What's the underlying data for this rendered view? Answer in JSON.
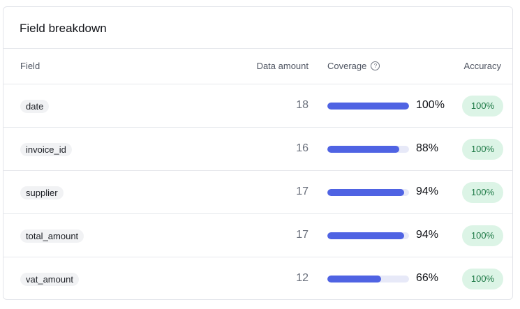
{
  "card": {
    "title": "Field breakdown"
  },
  "columns": {
    "field": "Field",
    "data_amount": "Data amount",
    "coverage": "Coverage",
    "accuracy": "Accuracy",
    "coverage_help_icon": "question-circle-icon"
  },
  "rows": [
    {
      "field": "date",
      "data_amount": "18",
      "coverage": "100%",
      "coverage_fraction": 1.0,
      "accuracy": "100%"
    },
    {
      "field": "invoice_id",
      "data_amount": "16",
      "coverage": "88%",
      "coverage_fraction": 0.88,
      "accuracy": "100%"
    },
    {
      "field": "supplier",
      "data_amount": "17",
      "coverage": "94%",
      "coverage_fraction": 0.94,
      "accuracy": "100%"
    },
    {
      "field": "total_amount",
      "data_amount": "17",
      "coverage": "94%",
      "coverage_fraction": 0.94,
      "accuracy": "100%"
    },
    {
      "field": "vat_amount",
      "data_amount": "12",
      "coverage": "66%",
      "coverage_fraction": 0.66,
      "accuracy": "100%"
    }
  ],
  "colors": {
    "bar_fill": "#4f63e3",
    "bar_track": "#e7e9f8",
    "accuracy_bg": "#dcf4e6",
    "accuracy_text": "#1f7a47"
  }
}
